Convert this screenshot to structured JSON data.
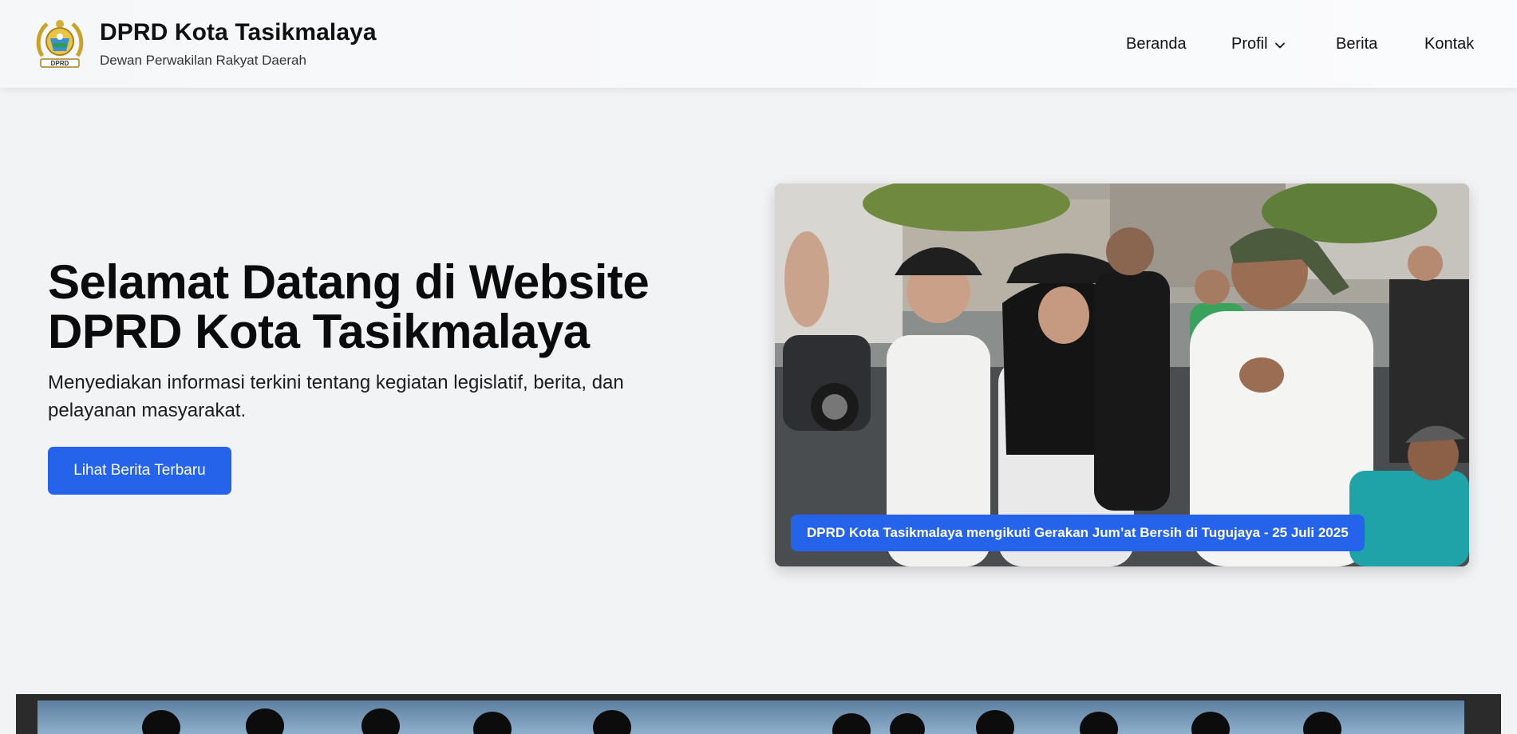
{
  "header": {
    "title": "DPRD Kota Tasikmalaya",
    "subtitle": "Dewan Perwakilan Rakyat Daerah",
    "logo_icon": "dprd-emblem-icon",
    "logo_text": "DPRD"
  },
  "nav": {
    "items": [
      {
        "label": "Beranda"
      },
      {
        "label": "Profil",
        "icon": "chevron-down-icon"
      },
      {
        "label": "Berita"
      },
      {
        "label": "Kontak"
      }
    ]
  },
  "hero": {
    "title": "Selamat Datang di Website DPRD Kota Tasikmalaya",
    "description": "Menyediakan informasi terkini tentang kegiatan legislatif, berita, dan pelayanan masyarakat.",
    "cta_label": "Lihat Berita Terbaru"
  },
  "slide": {
    "caption": "DPRD Kota Tasikmalaya mengikuti Gerakan Jum’at Bersih di Tugujaya - 25 Juli 2025"
  },
  "colors": {
    "accent": "#2563eb",
    "background": "#f2f3f5",
    "banner_frame": "#2b2b2b"
  }
}
